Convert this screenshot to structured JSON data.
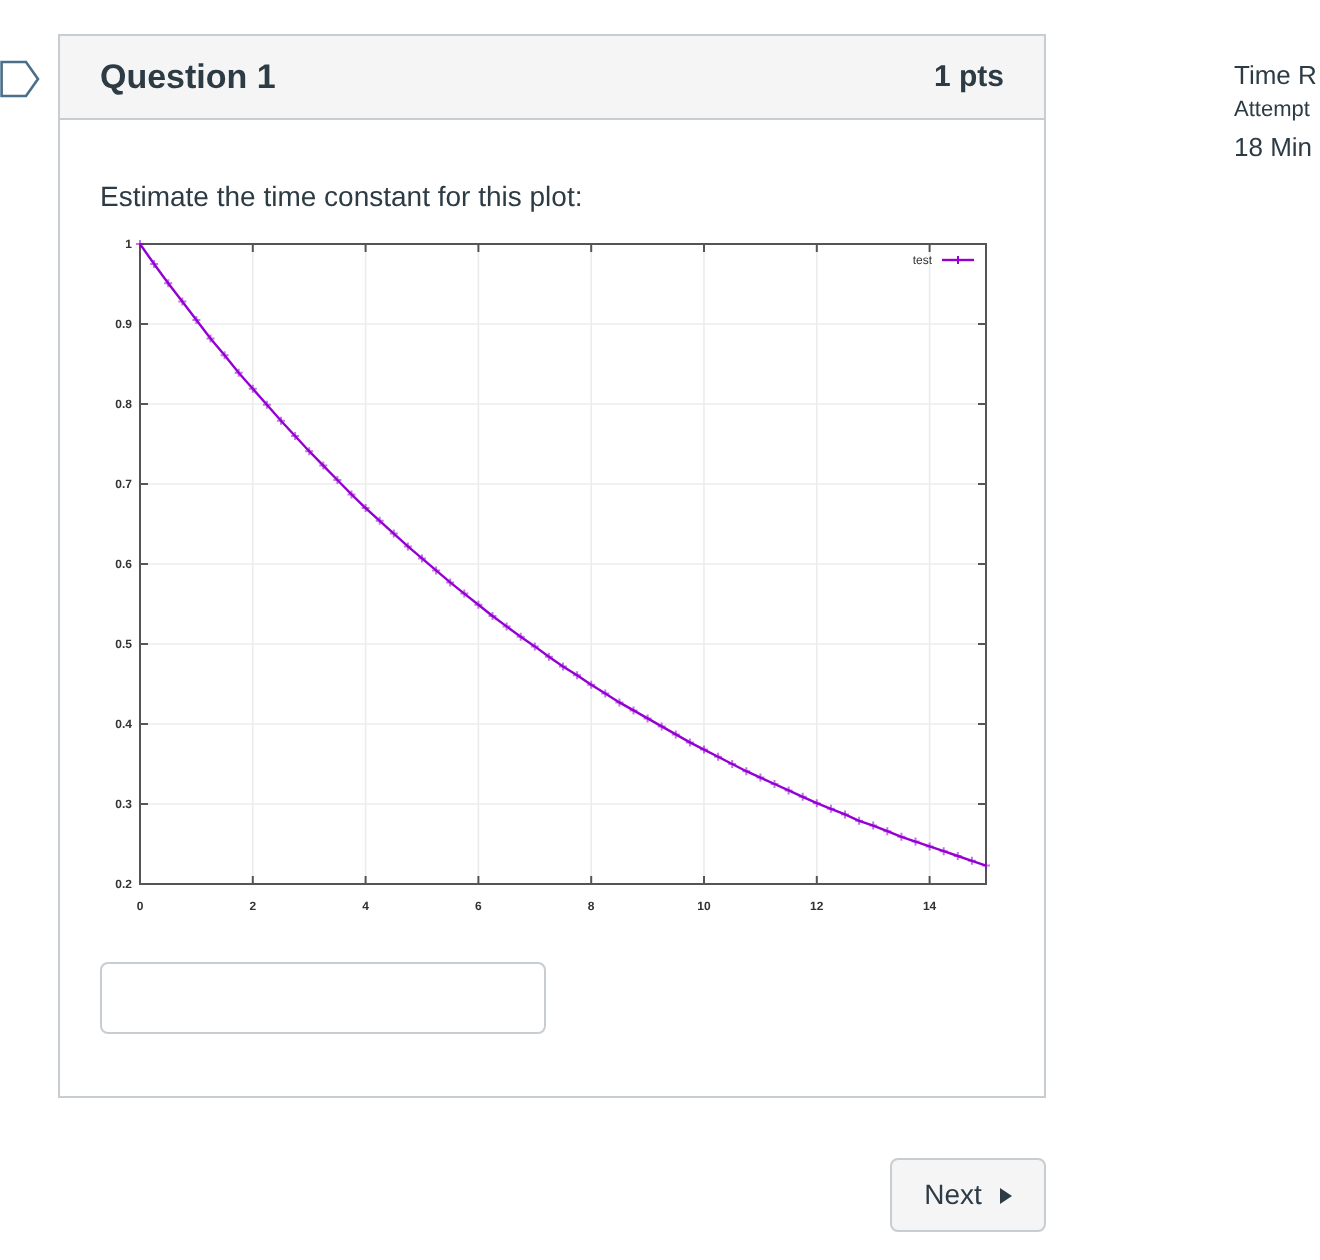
{
  "question": {
    "title": "Question 1",
    "points": "1 pts",
    "prompt": "Estimate the time constant for this plot:",
    "chart_data": {
      "type": "line",
      "grid": true,
      "x": [
        0,
        0.25,
        0.5,
        0.75,
        1,
        1.25,
        1.5,
        1.75,
        2,
        2.25,
        2.5,
        2.75,
        3,
        3.25,
        3.5,
        3.75,
        4,
        4.25,
        4.5,
        4.75,
        5,
        5.25,
        5.5,
        5.75,
        6,
        6.25,
        6.5,
        6.75,
        7,
        7.25,
        7.5,
        7.75,
        8,
        8.25,
        8.5,
        8.75,
        9,
        9.25,
        9.5,
        9.75,
        10,
        10.25,
        10.5,
        10.75,
        11,
        11.25,
        11.5,
        11.75,
        12,
        12.25,
        12.5,
        12.75,
        13,
        13.25,
        13.5,
        13.75,
        14,
        14.25,
        14.5,
        14.75,
        15
      ],
      "series": [
        {
          "name": "test",
          "color": "#9400d3",
          "marker": "+",
          "values": [
            1.0,
            0.975,
            0.951,
            0.928,
            0.905,
            0.882,
            0.861,
            0.839,
            0.819,
            0.799,
            0.779,
            0.76,
            0.741,
            0.723,
            0.705,
            0.687,
            0.67,
            0.654,
            0.638,
            0.622,
            0.607,
            0.592,
            0.577,
            0.563,
            0.549,
            0.535,
            0.522,
            0.509,
            0.497,
            0.484,
            0.472,
            0.461,
            0.449,
            0.438,
            0.427,
            0.417,
            0.407,
            0.397,
            0.387,
            0.377,
            0.368,
            0.359,
            0.35,
            0.341,
            0.333,
            0.325,
            0.317,
            0.309,
            0.301,
            0.294,
            0.287,
            0.279,
            0.273,
            0.266,
            0.259,
            0.253,
            0.247,
            0.241,
            0.235,
            0.229,
            0.223
          ]
        }
      ],
      "xlim": [
        0,
        15
      ],
      "ylim": [
        0.2,
        1
      ],
      "xticks": [
        0,
        2,
        4,
        6,
        8,
        10,
        12,
        14
      ],
      "yticks": [
        0.2,
        0.3,
        0.4,
        0.5,
        0.6,
        0.7,
        0.8,
        0.9,
        1
      ]
    }
  },
  "next_button": {
    "label": "Next"
  },
  "sidebar": {
    "time_label": "Time R",
    "attempt_label": "Attempt",
    "time_value": "18 Min"
  }
}
